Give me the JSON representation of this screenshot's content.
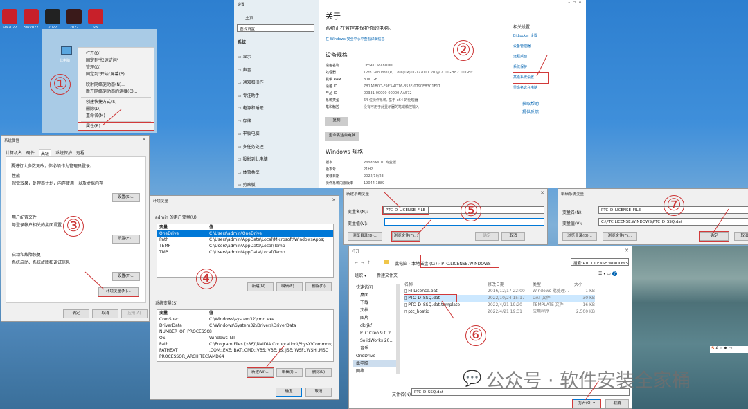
{
  "desktop": {
    "icons": [
      {
        "label": "SW2022",
        "color": "#c8202a"
      },
      {
        "label": "SW2022",
        "color": "#c8202a"
      },
      {
        "label": "2022",
        "color": "#222"
      },
      {
        "label": "2022",
        "color": "#3a1a1a"
      },
      {
        "label": "SW",
        "color": "#c8202a"
      }
    ]
  },
  "step_numbers": [
    "①",
    "②",
    "③",
    "④",
    "⑤",
    "⑥",
    "⑦"
  ],
  "context_menu": {
    "icon_label": "此电脑",
    "items": [
      "打开(O)",
      "固定到\"快速访问\"",
      "管理(G)",
      "固定到\"开始\"屏幕(P)",
      "映射网络驱动器(N)...",
      "断开网络驱动器的连接(C)...",
      "创建快捷方式(S)",
      "删除(D)",
      "重命名(M)",
      "属性(R)"
    ]
  },
  "settings": {
    "app": "设置",
    "home": "主页",
    "search_placeholder": "查找设置",
    "section": "系统",
    "nav": [
      "显示",
      "声音",
      "通知和操作",
      "专注助手",
      "电源和睡眠",
      "存储",
      "平板电脑",
      "多任务处理",
      "投影到此电脑",
      "体验共享",
      "剪贴板"
    ],
    "title": "关于",
    "protect": "系统正在监控并保护你的电脑。",
    "security_link": "在 Windows 安全中心中查看详细信息",
    "device_heading": "设备规格",
    "device_specs": [
      [
        "设备名称",
        "DESKTOP-L8UD0I"
      ],
      [
        "处理器",
        "12th Gen Intel(R) Core(TM) i7-12700 CPU @ 2.10GHz 2.10 GHz"
      ],
      [
        "机带 RAM",
        "8.00 GB"
      ],
      [
        "设备 ID",
        "7B1A1B0D-F9E3-4D16-B53F-0790EB3C1F17"
      ],
      [
        "产品 ID",
        "00331-00000-00000-AA572"
      ],
      [
        "系统类型",
        "64 位操作系统, 基于 x64 的处理器"
      ],
      [
        "笔和触控",
        "没有可用于此显示器的笔或触控输入"
      ]
    ],
    "copy_btn": "复制",
    "rename_btn": "重命名这台电脑",
    "windows_heading": "Windows 规格",
    "windows_specs": [
      [
        "版本",
        "Windows 10 专业版"
      ],
      [
        "版本号",
        "21H2"
      ],
      [
        "安装日期",
        "2022/10/23"
      ],
      [
        "操作系统内部版本",
        "19044.1889"
      ]
    ],
    "related_heading": "相关设置",
    "related": [
      "BitLocker 设置",
      "设备管理器",
      "远程桌面",
      "系统保护",
      "高级系统设置",
      "重命名这台电脑"
    ],
    "help": "获取帮助",
    "feedback": "提供反馈"
  },
  "sysprops": {
    "title": "系统属性",
    "tabs": [
      "计算机名",
      "硬件",
      "高级",
      "系统保护",
      "远程"
    ],
    "admin_note": "要进行大多数更改，你必须作为管理员登录。",
    "perf_h": "性能",
    "perf_d": "视觉效果，处理器计划，内存使用，以及虚拟内存",
    "perf_btn": "设置(S)...",
    "profile_h": "用户配置文件",
    "profile_d": "与登录帐户相关的桌面设置",
    "profile_btn": "设置(E)...",
    "startup_h": "启动和故障恢复",
    "startup_d": "系统启动、系统故障和调试信息",
    "startup_btn": "设置(T)...",
    "env_btn": "环境变量(N)...",
    "ok": "确定",
    "cancel": "取消",
    "apply": "应用(A)"
  },
  "envvars": {
    "title": "环境变量",
    "user_h": "admin 的用户变量(U)",
    "col_var": "变量",
    "col_val": "值",
    "user_vars": [
      [
        "OneDrive",
        "C:\\Users\\admin\\OneDrive"
      ],
      [
        "Path",
        "C:\\Users\\admin\\AppData\\Local\\Microsoft\\WindowsApps;"
      ],
      [
        "TEMP",
        "C:\\Users\\admin\\AppData\\Local\\Temp"
      ],
      [
        "TMP",
        "C:\\Users\\admin\\AppData\\Local\\Temp"
      ]
    ],
    "user_btns": [
      "新建(N)...",
      "编辑(E)...",
      "删除(D)"
    ],
    "sys_h": "系统变量(S)",
    "sys_vars": [
      [
        "ComSpec",
        "C:\\Windows\\system32\\cmd.exe"
      ],
      [
        "DriverData",
        "C:\\Windows\\System32\\Drivers\\DriverData"
      ],
      [
        "NUMBER_OF_PROCESSORS",
        "8"
      ],
      [
        "OS",
        "Windows_NT"
      ],
      [
        "Path",
        "C:\\Program Files (x86)\\NVIDIA Corporation\\PhysX\\Common;..."
      ],
      [
        "PATHEXT",
        ".COM;.EXE;.BAT;.CMD;.VBS;.VBE;.JS;.JSE;.WSF;.WSH;.MSC"
      ],
      [
        "PROCESSOR_ARCHITECT...",
        "AMD64"
      ]
    ],
    "sys_btns": [
      "新建(W)...",
      "编辑(I)...",
      "删除(L)"
    ],
    "ok": "确定",
    "cancel": "取消"
  },
  "newvar": {
    "title": "新建系统变量",
    "name_label": "变量名(N):",
    "name_value": "PTC_D_LICENSE_FILE",
    "value_label": "变量值(V):",
    "value_value": "",
    "browse_dir": "浏览目录(D)...",
    "browse_file": "浏览文件(F)...",
    "ok": "确定",
    "cancel": "取消"
  },
  "editvar": {
    "title": "编辑系统变量",
    "name_label": "变量名(N):",
    "name_value": "PTC_D_LICENSE_FILE",
    "value_label": "变量值(V):",
    "value_value": "C:\\PTC.LICENSE.WINDOWS\\PTC_D_SSQ.dat",
    "browse_dir": "浏览目录(D)...",
    "browse_file": "浏览文件(F)...",
    "ok": "确定",
    "cancel": "取消"
  },
  "open": {
    "title": "打开",
    "crumbs": [
      "此电脑",
      "本地磁盘 (C:)",
      "PTC.LICENSE.WINDOWS"
    ],
    "search": "搜索\"PTC.LICENSE.WINDOWS...\"",
    "organize": "组织 ▾",
    "new_folder": "新建文件夹",
    "nav": [
      "快速访问",
      "桌面",
      "下载",
      "文档",
      "图片",
      "dkrjkf",
      "PTC.Creo 9.0.2...",
      "SolidWorks 20...",
      "音乐",
      "OneDrive",
      "此电脑",
      "网络"
    ],
    "cols": [
      "名称",
      "修改日期",
      "类型",
      "大小"
    ],
    "files": [
      [
        "FillLicense.bat",
        "2016/12/17 22:00",
        "Windows 批处理...",
        "1 KB"
      ],
      [
        "PTC_D_SSQ.dat",
        "2022/10/24 15:17",
        "DAT 文件",
        "30 KB"
      ],
      [
        "PTC_D_SSQ.dat.template",
        "2022/4/21 19:20",
        "TEMPLATE 文件",
        "16 KB"
      ],
      [
        "ptc_hostid",
        "2022/4/21 19:31",
        "应用程序",
        "2,500 KB"
      ]
    ],
    "filename_label": "文件名(N):",
    "filename": "PTC_D_SSQ.dat",
    "open_btn": "打开(O)",
    "cancel": "取消"
  },
  "watermark": "公众号 · 软件安装全家桶",
  "accent": "#0078d7",
  "highlight": "#d23a3a"
}
